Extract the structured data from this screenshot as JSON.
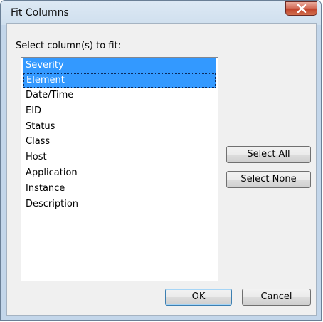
{
  "window": {
    "title": "Fit Columns"
  },
  "dialog": {
    "prompt": "Select column(s) to fit:",
    "columns": [
      {
        "label": "Severity",
        "selected": true
      },
      {
        "label": "Element",
        "selected": true
      },
      {
        "label": "Date/Time",
        "selected": false
      },
      {
        "label": "EID",
        "selected": false
      },
      {
        "label": "Status",
        "selected": false
      },
      {
        "label": "Class",
        "selected": false
      },
      {
        "label": "Host",
        "selected": false
      },
      {
        "label": "Application",
        "selected": false
      },
      {
        "label": "Instance",
        "selected": false
      },
      {
        "label": "Description",
        "selected": false
      }
    ],
    "select_all_label": "Select All",
    "select_none_label": "Select None",
    "ok_label": "OK",
    "cancel_label": "Cancel"
  },
  "colors": {
    "selection": "#3399ff",
    "client_bg": "#f0f0f0",
    "close_button": "#c0432b"
  },
  "icons": {
    "close": "close-icon"
  }
}
